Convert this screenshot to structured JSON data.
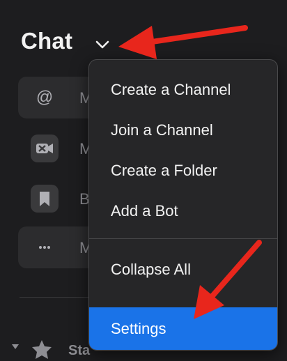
{
  "header": {
    "title": "Chat",
    "chevron_icon": "chevron-down-icon"
  },
  "sidebar": {
    "items": [
      {
        "icon": "at-sign-icon",
        "label_fragment": "M"
      },
      {
        "icon": "video-off-icon",
        "label_fragment": "M"
      },
      {
        "icon": "bookmark-icon",
        "label_fragment": "B"
      },
      {
        "icon": "more-icon",
        "label_fragment": "M"
      }
    ],
    "starred": {
      "label_fragment": "Sta",
      "icon": "star-icon"
    }
  },
  "menu": {
    "items": [
      {
        "label": "Create a Channel"
      },
      {
        "label": "Join a Channel"
      },
      {
        "label": "Create a Folder"
      },
      {
        "label": "Add a Bot"
      },
      {
        "label": "Collapse All"
      },
      {
        "label": "Settings",
        "selected": true
      }
    ]
  },
  "annotations": {
    "arrow_color": "#e8261c"
  },
  "colors": {
    "background": "#1d1d1f",
    "menu_background": "#262628",
    "selected": "#1a73e8"
  }
}
